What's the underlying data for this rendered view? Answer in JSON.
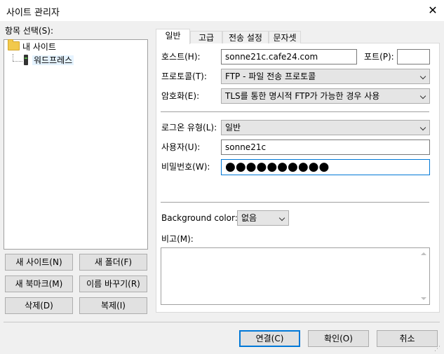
{
  "window": {
    "title": "사이트 관리자",
    "close_glyph": "✕"
  },
  "left": {
    "tree_label": "항목 선택(S):",
    "tree": [
      {
        "label": "내 사이트",
        "icon": "folder-icon"
      },
      {
        "label": "워드프레스",
        "icon": "server-icon",
        "selected": true
      }
    ],
    "buttons": {
      "new_site": "새 사이트(N)",
      "new_folder": "새 폴더(F)",
      "new_bookmark": "새 북마크(M)",
      "rename": "이름 바꾸기(R)",
      "delete": "삭제(D)",
      "copy": "복제(I)"
    }
  },
  "tabs": [
    {
      "label": "일반",
      "active": true
    },
    {
      "label": "고급"
    },
    {
      "label": "전송 설정"
    },
    {
      "label": "문자셋"
    }
  ],
  "general": {
    "host_label": "호스트(H):",
    "host_value": "sonne21c.cafe24.com",
    "port_label": "포트(P):",
    "port_value": "",
    "protocol_label": "프로토콜(T):",
    "protocol_value": "FTP - 파일 전송 프로토콜",
    "encryption_label": "암호화(E):",
    "encryption_value": "TLS를 통한 명시적 FTP가 가능한 경우 사용",
    "logon_label": "로그온 유형(L):",
    "logon_value": "일반",
    "user_label": "사용자(U):",
    "user_value": "sonne21c",
    "password_label": "비밀번호(W):",
    "password_value": "●●●●●●●●●●",
    "bgcolor_label": "Background color:",
    "bgcolor_value": "없음",
    "comments_label": "비고(M):"
  },
  "footer": {
    "connect": "연결(C)",
    "ok": "확인(O)",
    "cancel": "취소"
  },
  "colors": {
    "accent": "#0078d7",
    "selection": "#e5f3ff"
  }
}
